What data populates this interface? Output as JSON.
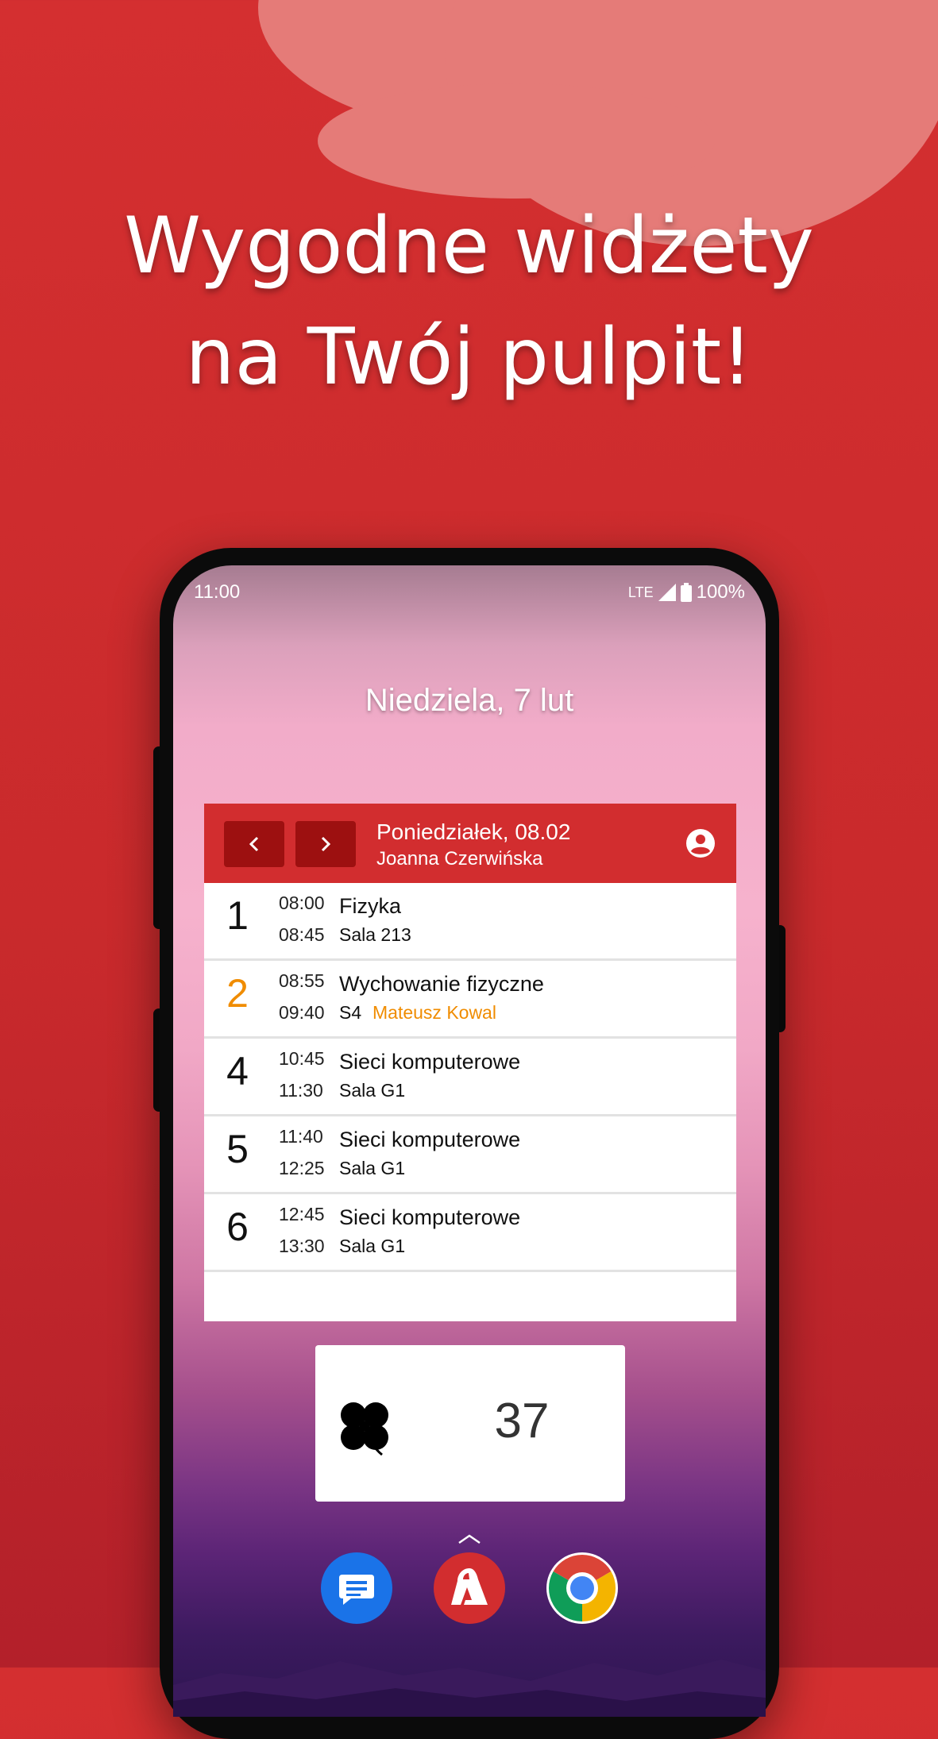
{
  "promo": {
    "headline_line1": "Wygodne widżety",
    "headline_line2": "na Twój pulpit!"
  },
  "statusbar": {
    "time": "11:00",
    "network": "LTE",
    "battery": "100%"
  },
  "lockscreen": {
    "date": "Niedziela, 7 lut"
  },
  "timetable_widget": {
    "day": "Poniedziałek, 08.02",
    "student": "Joanna Czerwińska",
    "prev_icon": "chevron-left-icon",
    "next_icon": "chevron-right-icon",
    "account_icon": "account-circle-icon",
    "lessons": [
      {
        "number": "1",
        "start": "08:00",
        "end": "08:45",
        "subject": "Fizyka",
        "room": "Sala 213",
        "teacher": ""
      },
      {
        "number": "2",
        "start": "08:55",
        "end": "09:40",
        "subject": "Wychowanie fizyczne",
        "room": "S4",
        "teacher": "Mateusz Kowal"
      },
      {
        "number": "4",
        "start": "10:45",
        "end": "11:30",
        "subject": "Sieci komputerowe",
        "room": "Sala G1",
        "teacher": ""
      },
      {
        "number": "5",
        "start": "11:40",
        "end": "12:25",
        "subject": "Sieci komputerowe",
        "room": "Sala G1",
        "teacher": ""
      },
      {
        "number": "6",
        "start": "12:45",
        "end": "13:30",
        "subject": "Sieci komputerowe",
        "room": "Sala G1",
        "teacher": ""
      }
    ]
  },
  "lucky_number_widget": {
    "icon": "clover-icon",
    "number": "37"
  },
  "dock": {
    "apps": [
      "messages-icon",
      "school-app-icon",
      "chrome-icon"
    ]
  },
  "colors": {
    "background": "#d42f30",
    "accent": "#d22d2f",
    "nav_button": "#9d1010",
    "highlight": "#f08c00"
  }
}
